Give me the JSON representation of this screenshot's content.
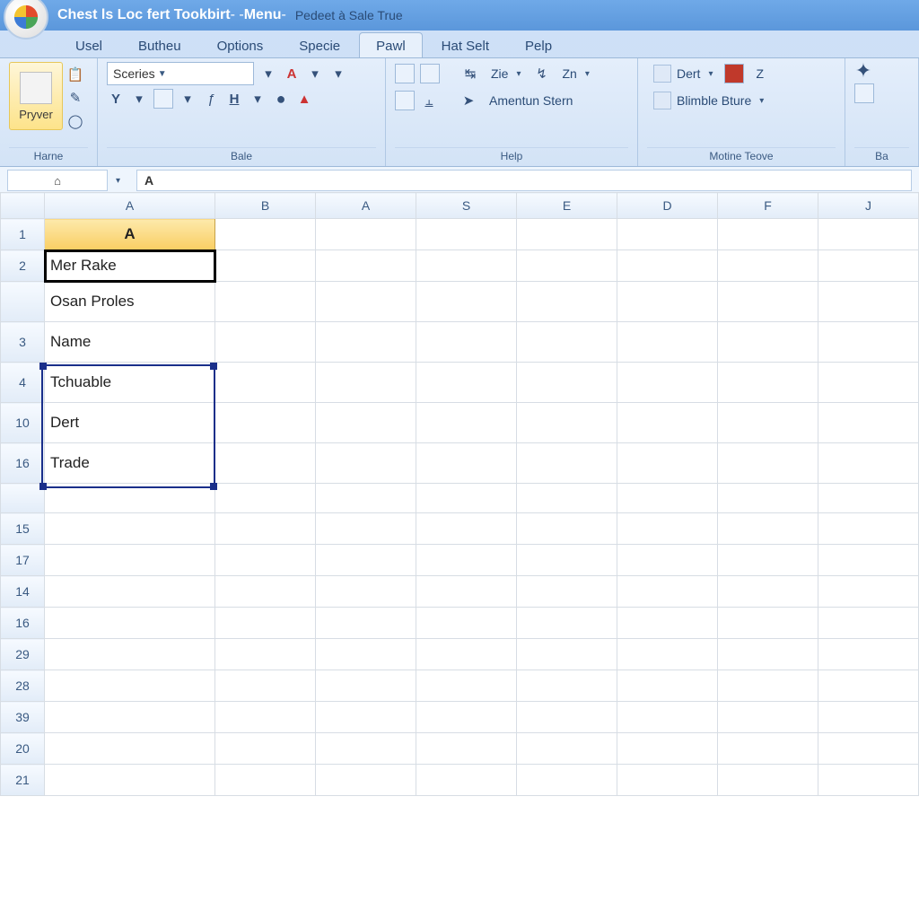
{
  "titlebar": {
    "app_title": "Chest ls Loc fert Tookbirt",
    "sep1": " -  - ",
    "menu_label": "Menu",
    "sep2": " - ",
    "subtitle": "Pedeet à Sale True"
  },
  "menu": {
    "items": [
      "Usel",
      "Butheu",
      "Options",
      "Specie",
      "Pawl",
      "Hat Selt",
      "Pelp"
    ],
    "active_index": 4
  },
  "ribbon": {
    "group0": {
      "big_button": "Pryver",
      "label": "Harne"
    },
    "group1": {
      "font_name": "Sceries",
      "label": "Bale"
    },
    "group2": {
      "btn_zie": "Zie",
      "btn_zn": "Zn",
      "btn_amentun": "Amentun Stern",
      "label": "Help"
    },
    "group3": {
      "btn_dert": "Dert",
      "btn_z": "Z",
      "btn_blimble": "Blimble Bture",
      "label": "Motine Teove"
    },
    "group4": {
      "label": "Ba"
    }
  },
  "formula_bar": {
    "name_box_icon": "⌂",
    "fx_content": "A"
  },
  "grid": {
    "columns": [
      "A",
      "B",
      "A",
      "S",
      "E",
      "D",
      "F",
      "J"
    ],
    "rows_left": [
      "1",
      "2",
      "",
      "3",
      "4",
      "10",
      "16",
      "",
      "15",
      "17",
      "14",
      "16",
      "29",
      "28",
      "39",
      "20",
      "21"
    ],
    "cells": {
      "A1": "A",
      "A2": "Mer Rake",
      "A2b": "Osan Proles",
      "A3": "Name",
      "A4": "Tchuable",
      "A10": "Dert",
      "A16": "Trade"
    }
  },
  "colors": {
    "accent": "#5b97db",
    "selection": "#1a2f8a",
    "header_fill": "#f9ce63"
  }
}
